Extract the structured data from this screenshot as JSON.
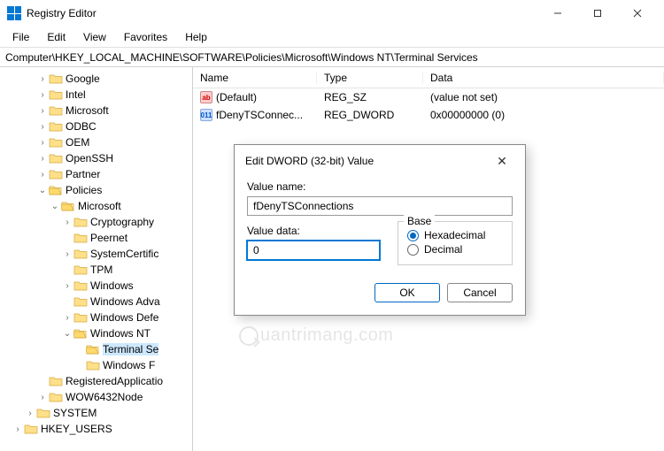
{
  "window": {
    "title": "Registry Editor",
    "controls": {
      "min": "minimize",
      "max": "maximize",
      "close": "close"
    }
  },
  "menu": [
    "File",
    "Edit",
    "View",
    "Favorites",
    "Help"
  ],
  "address": "Computer\\HKEY_LOCAL_MACHINE\\SOFTWARE\\Policies\\Microsoft\\Windows NT\\Terminal Services",
  "tree": {
    "items": [
      {
        "indent": 3,
        "chev": ">",
        "label": "Google"
      },
      {
        "indent": 3,
        "chev": ">",
        "label": "Intel"
      },
      {
        "indent": 3,
        "chev": ">",
        "label": "Microsoft"
      },
      {
        "indent": 3,
        "chev": ">",
        "label": "ODBC"
      },
      {
        "indent": 3,
        "chev": ">",
        "label": "OEM"
      },
      {
        "indent": 3,
        "chev": ">",
        "label": "OpenSSH"
      },
      {
        "indent": 3,
        "chev": ">",
        "label": "Partner"
      },
      {
        "indent": 3,
        "chev": "v",
        "label": "Policies",
        "open": true
      },
      {
        "indent": 4,
        "chev": "v",
        "label": "Microsoft",
        "open": true
      },
      {
        "indent": 5,
        "chev": ">",
        "label": "Cryptography"
      },
      {
        "indent": 5,
        "chev": "",
        "label": "Peernet"
      },
      {
        "indent": 5,
        "chev": ">",
        "label": "SystemCertific"
      },
      {
        "indent": 5,
        "chev": "",
        "label": "TPM"
      },
      {
        "indent": 5,
        "chev": ">",
        "label": "Windows"
      },
      {
        "indent": 5,
        "chev": "",
        "label": "Windows Adva"
      },
      {
        "indent": 5,
        "chev": ">",
        "label": "Windows Defe"
      },
      {
        "indent": 5,
        "chev": "v",
        "label": "Windows NT",
        "open": true
      },
      {
        "indent": 6,
        "chev": "",
        "label": "Terminal Se",
        "open": true,
        "selected": true
      },
      {
        "indent": 6,
        "chev": "",
        "label": "Windows F"
      },
      {
        "indent": 3,
        "chev": "",
        "label": "RegisteredApplicatio"
      },
      {
        "indent": 3,
        "chev": ">",
        "label": "WOW6432Node"
      },
      {
        "indent": 2,
        "chev": ">",
        "label": "SYSTEM"
      },
      {
        "indent": 1,
        "chev": ">",
        "label": "HKEY_USERS"
      }
    ]
  },
  "list": {
    "headers": {
      "name": "Name",
      "type": "Type",
      "data": "Data"
    },
    "rows": [
      {
        "icon": "sz",
        "name": "(Default)",
        "type": "REG_SZ",
        "data": "(value not set)"
      },
      {
        "icon": "dw",
        "name": "fDenyTSConnec...",
        "type": "REG_DWORD",
        "data": "0x00000000 (0)"
      }
    ]
  },
  "dialog": {
    "title": "Edit DWORD (32-bit) Value",
    "value_name_label": "Value name:",
    "value_name": "fDenyTSConnections",
    "value_data_label": "Value data:",
    "value_data": "0",
    "base_label": "Base",
    "hex": "Hexadecimal",
    "dec": "Decimal",
    "ok": "OK",
    "cancel": "Cancel"
  },
  "watermark": "uantrimang.com"
}
